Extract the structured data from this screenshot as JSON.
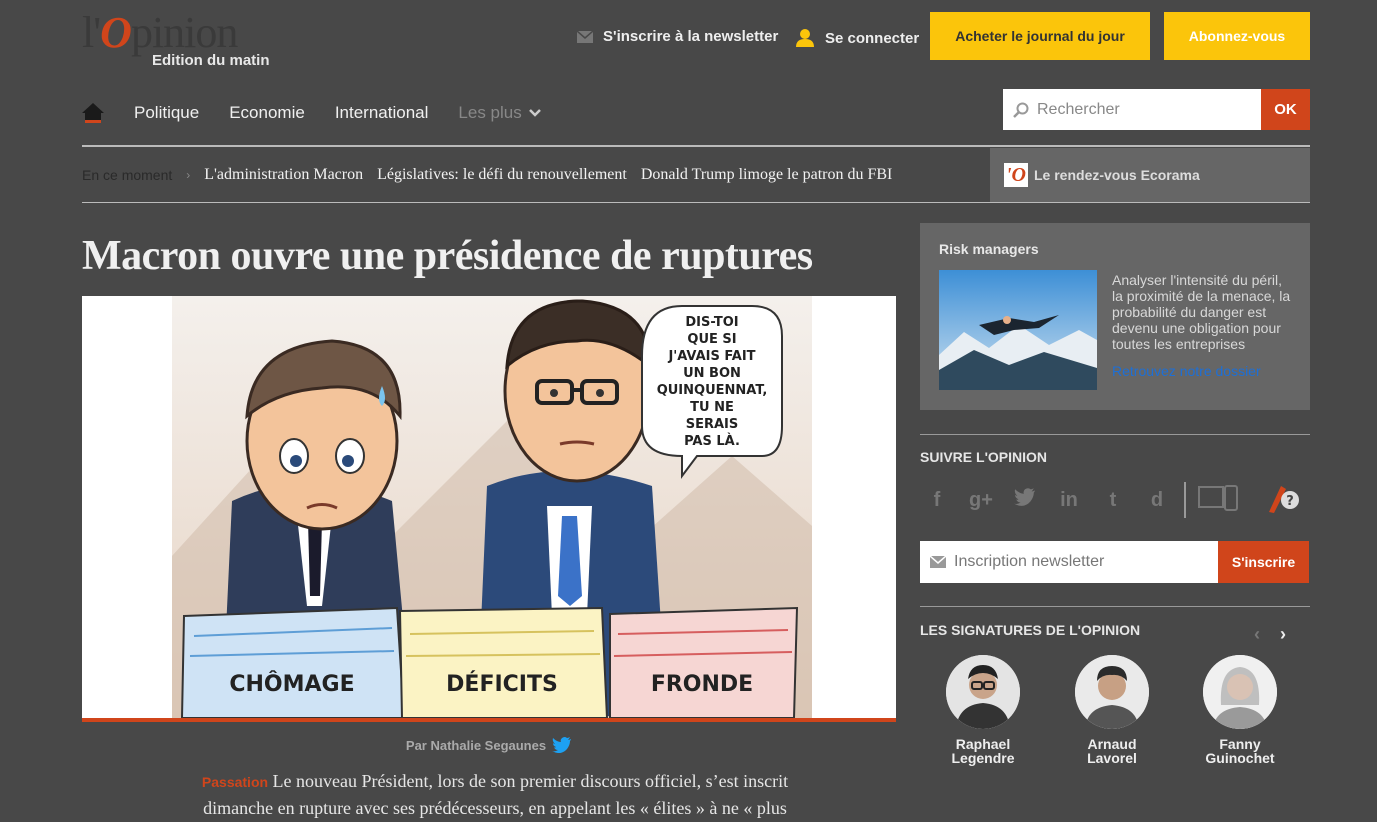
{
  "header": {
    "logo_text_pre": "l'",
    "logo_text_o": "O",
    "logo_text_post": "pinion",
    "edition": "Edition du matin",
    "newsletter_link": "S'inscrire à la newsletter",
    "login_link": "Se connecter",
    "buy_button": "Acheter le journal du jour",
    "subscribe_button": "Abonnez-vous"
  },
  "nav": {
    "items": [
      "Politique",
      "Economie",
      "International"
    ],
    "more": "Les plus",
    "search_placeholder": "Rechercher",
    "search_button": "OK"
  },
  "ticker": {
    "label": "En ce moment",
    "items": [
      "L'administration Macron",
      "Législatives: le défi du renouvellement",
      "Donald Trump limoge le patron du FBI"
    ],
    "ecorama": "Le rendez-vous Ecorama",
    "ecorama_logo": "'O"
  },
  "article": {
    "headline": "Macron ouvre une présidence de ruptures",
    "cartoon": {
      "bubble": [
        "DIS-TOI",
        "QUE SI",
        "J'AVAIS FAIT",
        "UN BON",
        "QUINQUENNAT,",
        "TU NE",
        "SERAIS",
        "PAS LÀ."
      ],
      "stacks": [
        "CHÔMAGE",
        "DÉFICITS",
        "FRONDE"
      ]
    },
    "byline": "Par Nathalie Segaunes",
    "kicker": "Passation",
    "lede": "Le nouveau Président, lors de son premier discours officiel, s’est inscrit dimanche en rupture avec ses prédécesseurs, en appelant les « élites » à ne « plus"
  },
  "sidebar": {
    "risk": {
      "title": "Risk managers",
      "text": "Analyser l'intensité du péril, la proximité de la menace, la probabilité du danger est devenu une obligation pour toutes les entreprises",
      "link": "Retrouvez notre dossier"
    },
    "follow_heading": "SUIVRE L'OPINION",
    "social": [
      "f",
      "g+",
      "t",
      "in",
      "t",
      "d"
    ],
    "newsletter_placeholder": "Inscription newsletter",
    "newsletter_button": "S'inscrire",
    "signatures_heading": "LES SIGNATURES DE L'OPINION",
    "signatures": [
      {
        "first": "Raphael",
        "last": "Legendre"
      },
      {
        "first": "Arnaud",
        "last": "Lavorel"
      },
      {
        "first": "Fanny",
        "last": "Guinochet"
      }
    ]
  },
  "colors": {
    "accent": "#d0451b",
    "yellow": "#fbc50b",
    "background": "#484848"
  }
}
